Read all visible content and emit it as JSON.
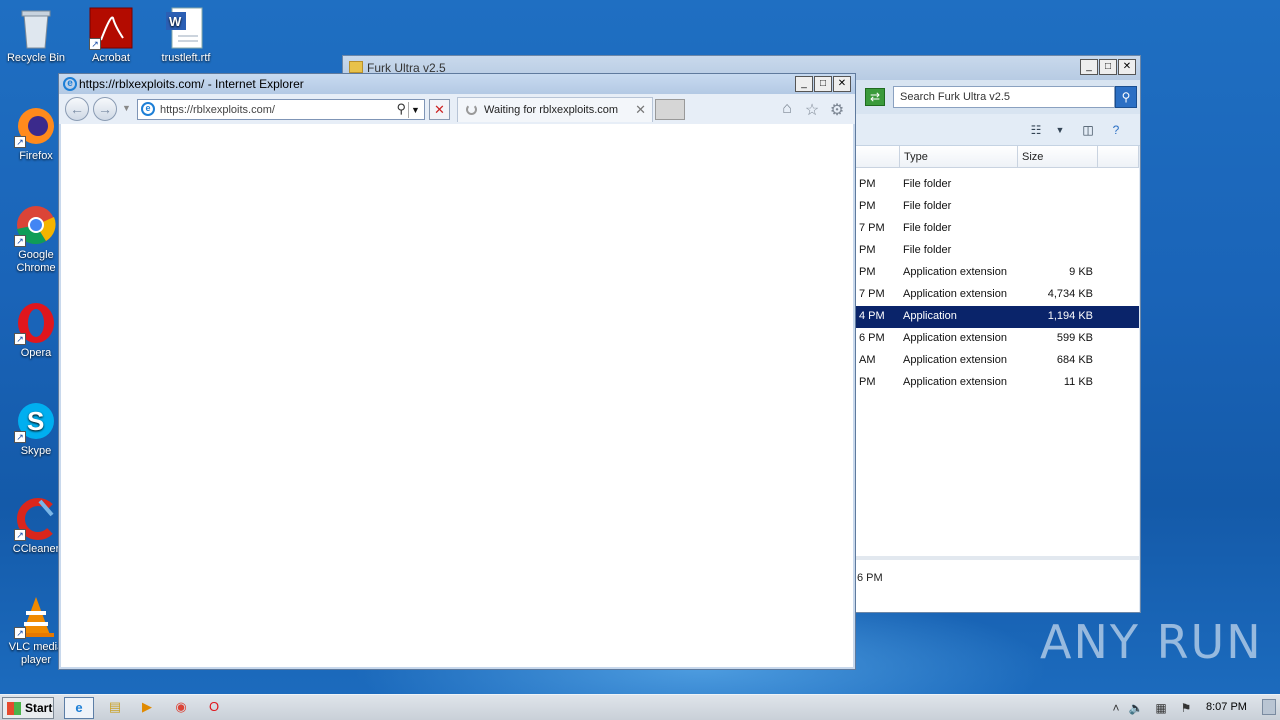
{
  "desktop": {
    "icons": [
      {
        "label": "Recycle Bin"
      },
      {
        "label": "Acrobat"
      },
      {
        "label": "trustleft.rtf"
      },
      {
        "label": "Firefox"
      },
      {
        "label": "Google Chrome"
      },
      {
        "label": "Opera"
      },
      {
        "label": "Skype"
      },
      {
        "label": "CCleaner"
      },
      {
        "label": "VLC media player"
      }
    ]
  },
  "explorer": {
    "title": "Furk Ultra v2.5",
    "search_placeholder": "Search Furk Ultra v2.5",
    "columns": {
      "type": "Type",
      "size": "Size"
    },
    "rows": [
      {
        "time": "PM",
        "type": "File folder",
        "size": ""
      },
      {
        "time": "PM",
        "type": "File folder",
        "size": ""
      },
      {
        "time": "7 PM",
        "type": "File folder",
        "size": ""
      },
      {
        "time": "PM",
        "type": "File folder",
        "size": ""
      },
      {
        "time": "PM",
        "type": "Application extension",
        "size": "9 KB"
      },
      {
        "time": "7 PM",
        "type": "Application extension",
        "size": "4,734 KB"
      },
      {
        "time": "4 PM",
        "type": "Application",
        "size": "1,194 KB"
      },
      {
        "time": "6 PM",
        "type": "Application extension",
        "size": "599 KB"
      },
      {
        "time": "AM",
        "type": "Application extension",
        "size": "684 KB"
      },
      {
        "time": "PM",
        "type": "Application extension",
        "size": "11 KB"
      }
    ],
    "status_text": "6 PM"
  },
  "ie": {
    "title": "https://rblxexploits.com/ - Internet Explorer",
    "url": "https://rblxexploits.com/",
    "tab_label": "Waiting for rblxexploits.com"
  },
  "watermark": "ANY RUN",
  "taskbar": {
    "start_label": "Start",
    "clock": "8:07 PM"
  }
}
